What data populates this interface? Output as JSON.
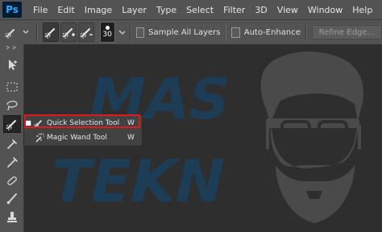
{
  "app": {
    "logo": "Ps"
  },
  "menu": [
    "File",
    "Edit",
    "Image",
    "Layer",
    "Type",
    "Select",
    "Filter",
    "3D",
    "View",
    "Window",
    "Help"
  ],
  "options": {
    "brush_size": "30",
    "sample_all_layers": "Sample All Layers",
    "auto_enhance": "Auto-Enhance",
    "refine_edge": "Refine Edge..."
  },
  "tool_flyout": {
    "items": [
      {
        "label": "Quick Selection Tool",
        "shortcut": "W",
        "selected": true
      },
      {
        "label": "Magic Wand Tool",
        "shortcut": "W",
        "selected": false
      }
    ],
    "bullet": "■"
  },
  "watermark": {
    "line1": "MAS",
    "line2": "TEKN"
  },
  "colors": {
    "highlight": "#e01a1a",
    "watermark_text": "#1d3d57",
    "logo_bg": "#001d34",
    "logo_fg": "#31a8ff"
  }
}
